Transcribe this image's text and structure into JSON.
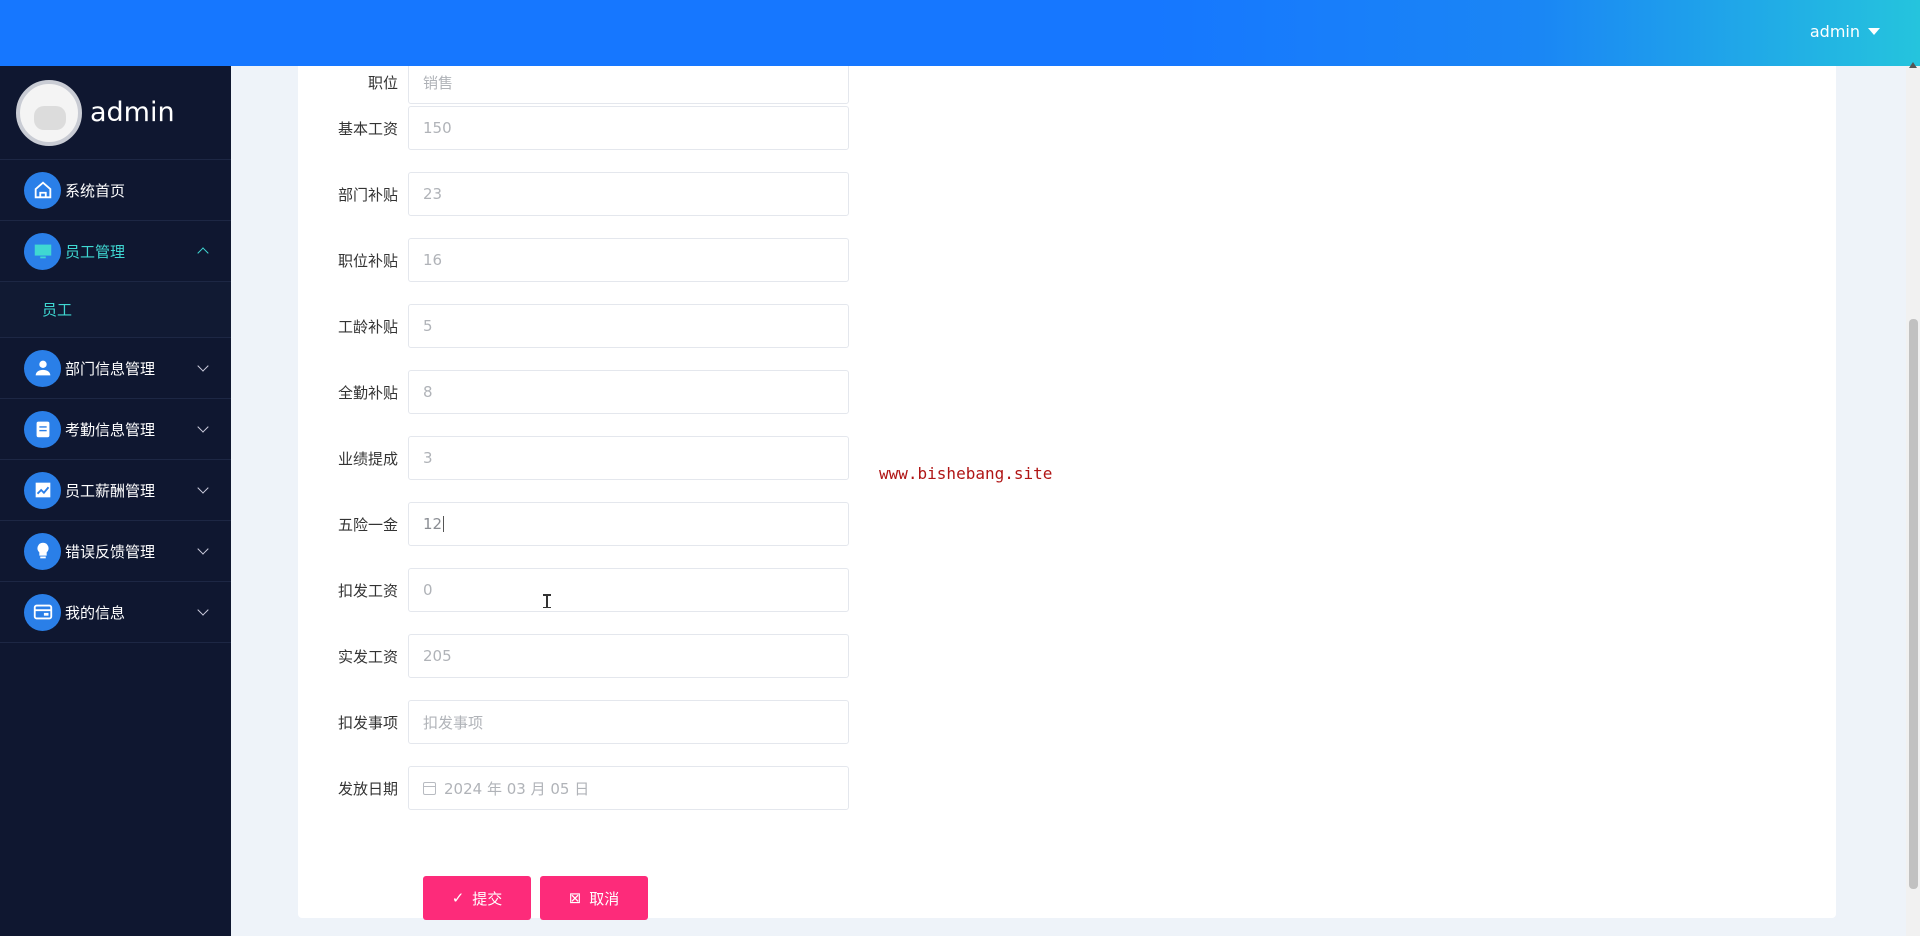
{
  "topbar": {
    "user": "admin"
  },
  "sidebar": {
    "name": "admin",
    "items": [
      {
        "label": "系统首页",
        "icon": "home-icon"
      },
      {
        "label": "员工管理",
        "icon": "monitor-icon",
        "expanded": true,
        "sub": [
          {
            "label": "员工"
          }
        ]
      },
      {
        "label": "部门信息管理",
        "icon": "person-icon"
      },
      {
        "label": "考勤信息管理",
        "icon": "clipboard-icon"
      },
      {
        "label": "员工薪酬管理",
        "icon": "chart-icon"
      },
      {
        "label": "错误反馈管理",
        "icon": "bulb-icon"
      },
      {
        "label": "我的信息",
        "icon": "card-icon"
      }
    ]
  },
  "form": {
    "fields": [
      {
        "label": "职位",
        "value": "销售"
      },
      {
        "label": "基本工资",
        "value": "150"
      },
      {
        "label": "部门补贴",
        "value": "23"
      },
      {
        "label": "职位补贴",
        "value": "16"
      },
      {
        "label": "工龄补贴",
        "value": "5"
      },
      {
        "label": "全勤补贴",
        "value": "8"
      },
      {
        "label": "业绩提成",
        "value": "3"
      },
      {
        "label": "五险一金",
        "value": "12"
      },
      {
        "label": "扣发工资",
        "value": "0"
      },
      {
        "label": "实发工资",
        "value": "205"
      },
      {
        "label": "扣发事项",
        "placeholder": "扣发事项"
      },
      {
        "label": "发放日期",
        "value": "2024 年 03 月 05 日"
      }
    ],
    "submit": "提交",
    "cancel": "取消"
  },
  "watermark": "www.bishebang.site"
}
